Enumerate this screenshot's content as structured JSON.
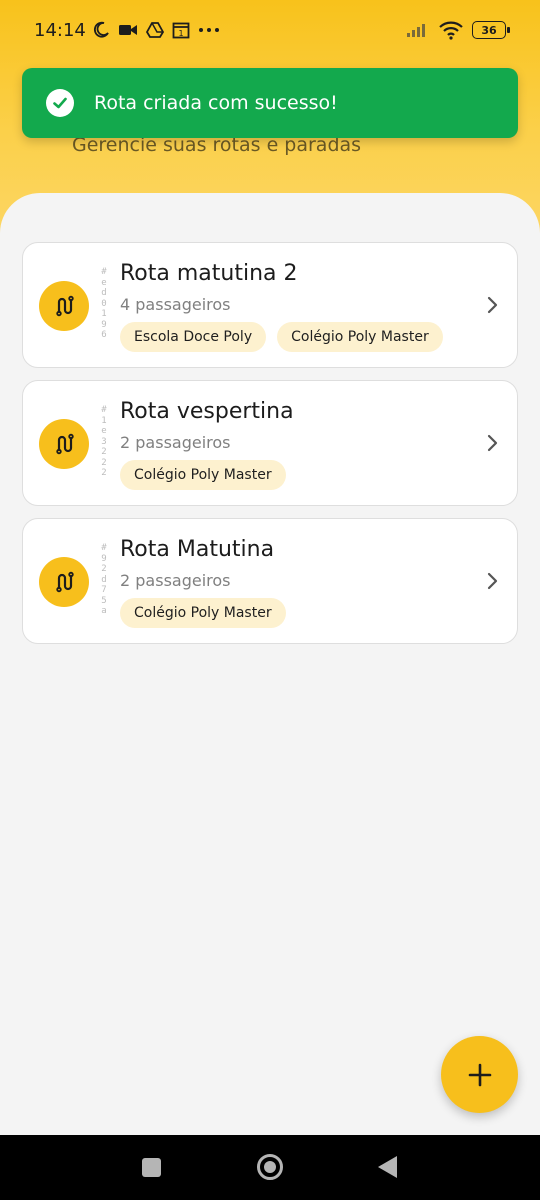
{
  "status_bar": {
    "time": "14:14",
    "battery": "36",
    "icons": [
      "moon-icon",
      "video-camera-icon",
      "drive-icon",
      "calendar-icon",
      "more-dots-icon",
      "signal-icon",
      "wifi-icon",
      "battery-icon"
    ]
  },
  "header": {
    "subtitle": "Gerencie suas rotas e paradas"
  },
  "toast": {
    "message": "Rota criada com sucesso!",
    "color": "#13a94d"
  },
  "routes": [
    {
      "title": "Rota matutina 2",
      "id": "#ed0196",
      "passengers": "4 passageiros",
      "tags": [
        "Escola Doce Poly",
        "Colégio Poly Master"
      ]
    },
    {
      "title": "Rota vespertina",
      "id": "#1e3222",
      "passengers": "2 passageiros",
      "tags": [
        "Colégio Poly Master"
      ]
    },
    {
      "title": "Rota Matutina",
      "id": "#92d75a",
      "passengers": "2 passageiros",
      "tags": [
        "Colégio Poly Master"
      ]
    }
  ],
  "fab": {
    "icon": "plus-icon"
  },
  "colors": {
    "accent": "#f7bf1c",
    "tag_bg": "#fdf1cf",
    "success": "#13a94d"
  }
}
